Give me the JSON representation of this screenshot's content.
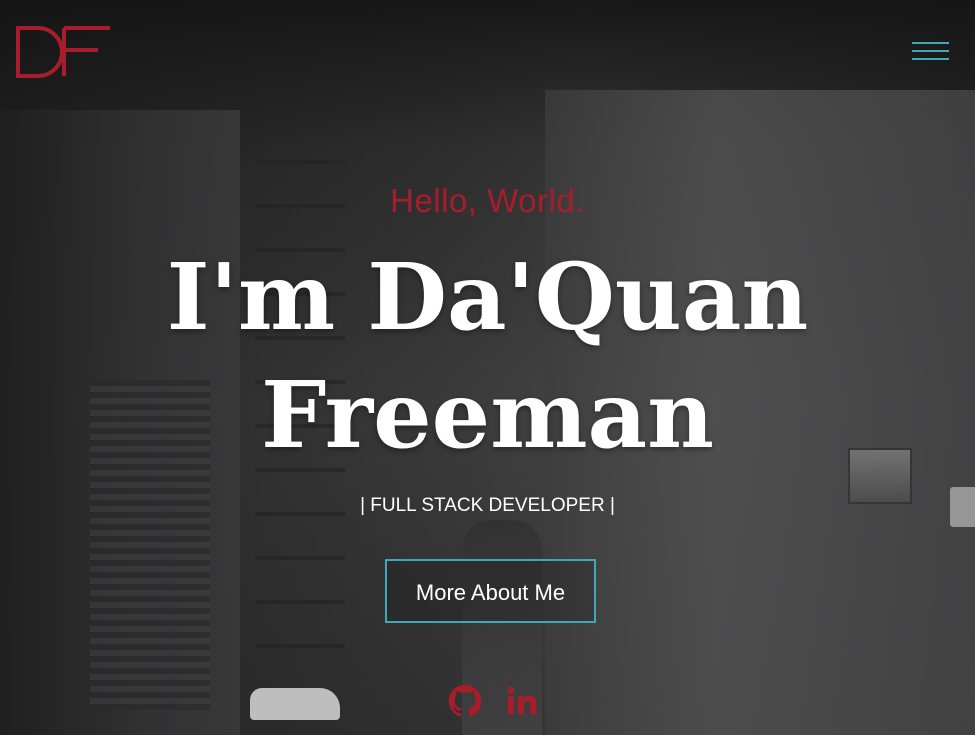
{
  "header": {
    "logo_text": "DF",
    "menu_icon": "hamburger-menu-icon"
  },
  "hero": {
    "greeting": "Hello, World.",
    "name_line1": "I'm Da'Quan",
    "name_line2": "Freeman",
    "subtitle": "| FULL STACK DEVELOPER |",
    "cta_label": "More About Me"
  },
  "social": [
    {
      "icon": "github-icon"
    },
    {
      "icon": "linkedin-icon"
    }
  ],
  "colors": {
    "accent_red": "#a71d2c",
    "accent_teal": "#3fa7b7",
    "text": "#ffffff",
    "background": "#1a1a1b"
  }
}
